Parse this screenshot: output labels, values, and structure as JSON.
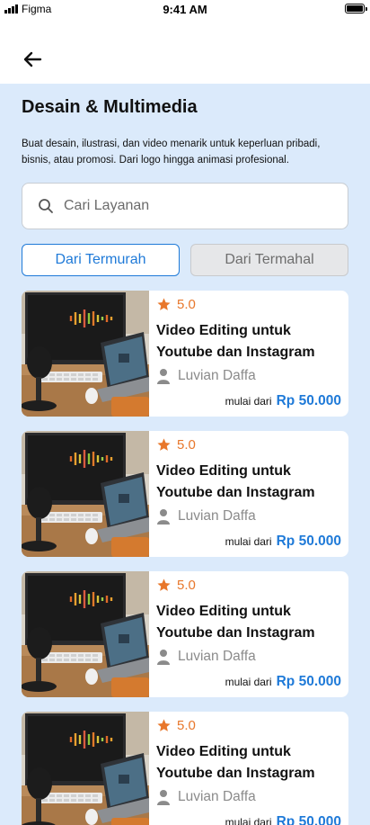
{
  "status_bar": {
    "carrier": "Figma",
    "time": "9:41 AM"
  },
  "header": {
    "back_icon": "arrow-left-icon"
  },
  "page": {
    "title": "Desain & Multimedia",
    "description": "Buat desain, ilustrasi, dan video menarik untuk keperluan pribadi, bisnis, atau promosi. Dari logo hingga animasi profesional."
  },
  "search": {
    "placeholder": "Cari Layanan",
    "value": ""
  },
  "sort": {
    "cheapest_label": "Dari Termurah",
    "most_expensive_label": "Dari Termahal",
    "active": "cheapest"
  },
  "services": [
    {
      "rating": "5.0",
      "title": "Video Editing untuk Youtube dan Instagram",
      "author": "Luvian Daffa",
      "price_prefix": "mulai dari",
      "price": "Rp 50.000"
    },
    {
      "rating": "5.0",
      "title": "Video Editing untuk Youtube dan Instagram",
      "author": "Luvian Daffa",
      "price_prefix": "mulai dari",
      "price": "Rp 50.000"
    },
    {
      "rating": "5.0",
      "title": "Video Editing untuk Youtube dan Instagram",
      "author": "Luvian Daffa",
      "price_prefix": "mulai dari",
      "price": "Rp 50.000"
    },
    {
      "rating": "5.0",
      "title": "Video Editing untuk Youtube dan Instagram",
      "author": "Luvian Daffa",
      "price_prefix": "mulai dari",
      "price": "Rp 50.000"
    }
  ],
  "colors": {
    "accent": "#1f7ad8",
    "star": "#e8772b",
    "background": "#dbeafb"
  }
}
